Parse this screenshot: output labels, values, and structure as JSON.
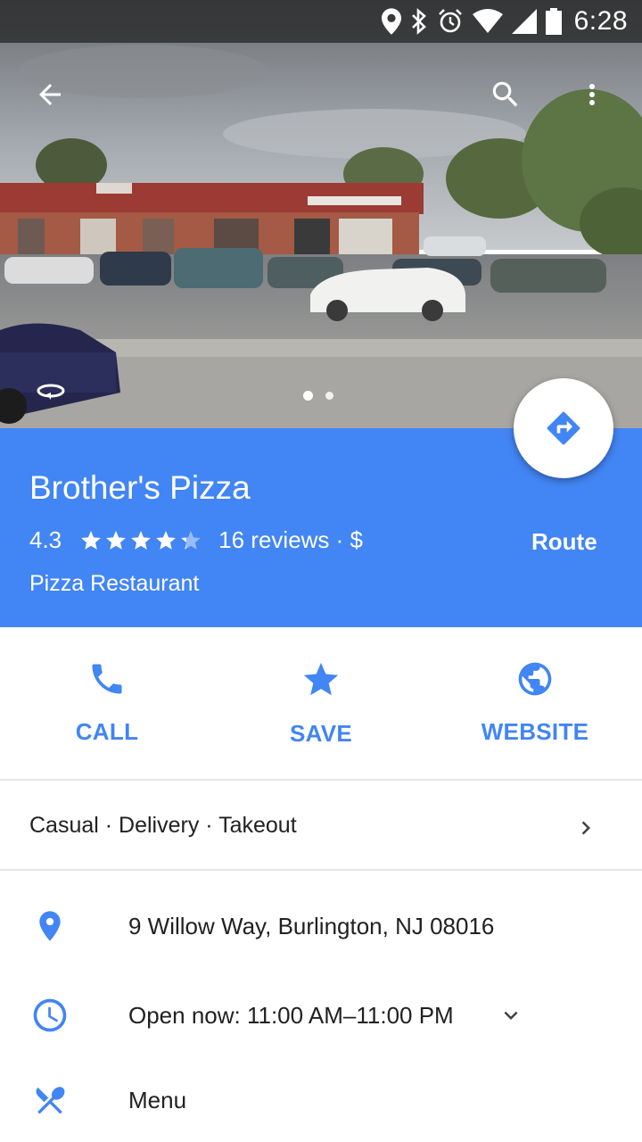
{
  "status_bar": {
    "time": "6:28",
    "icons": [
      "location-icon",
      "bluetooth-icon",
      "alarm-icon",
      "wifi-icon",
      "signal-icon",
      "battery-icon"
    ]
  },
  "top_bar": {
    "back_icon": "arrow-back-icon",
    "search_icon": "search-icon",
    "more_icon": "more-vert-icon"
  },
  "photo": {
    "pages": 2,
    "current_page": 1
  },
  "place": {
    "name": "Brother's Pizza",
    "rating": "4.3",
    "stars": 4.3,
    "meta": "16 reviews · $",
    "category": "Pizza Restaurant",
    "route_label": "Route"
  },
  "actions": [
    {
      "label": "CALL",
      "icon": "phone-icon"
    },
    {
      "label": "SAVE",
      "icon": "star-icon"
    },
    {
      "label": "WEBSITE",
      "icon": "globe-icon"
    }
  ],
  "attributes": "Casual · Delivery · Takeout",
  "info": {
    "address": "9 Willow Way, Burlington, NJ 08016",
    "hours": "Open now: 11:00 AM–11:00 PM",
    "menu": "Menu"
  },
  "colors": {
    "accent": "#4285f4",
    "header_bg": "#4285f4"
  }
}
